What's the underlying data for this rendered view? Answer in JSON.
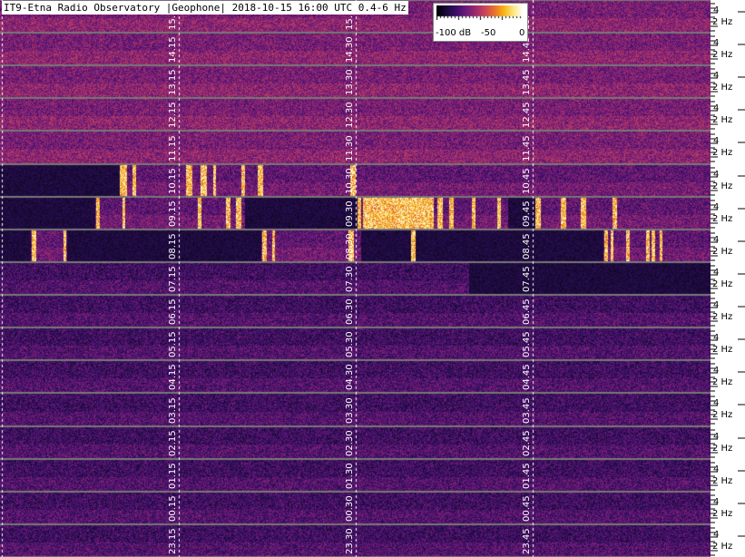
{
  "title": "IT9-Etna Radio Observatory |Geophone| 2018-10-15 16:00 UTC 0.4-6 Hz",
  "colorbar": {
    "min_label": "-100 dB",
    "mid_label": "-50",
    "max_label": "0",
    "colors": [
      "#000000",
      "#1a0b3b",
      "#3c0f69",
      "#6b1a7a",
      "#9b2b6e",
      "#c8455a",
      "#e8722e",
      "#f8b514",
      "#fbe985",
      "#ffffff"
    ]
  },
  "freq_labels": [
    "4",
    "2 Hz"
  ],
  "rows": [
    {
      "labels": [
        "15.",
        "15.",
        "15."
      ],
      "activity": "normal"
    },
    {
      "labels": [
        "14.15",
        "14.30",
        "14.45"
      ],
      "activity": "normal"
    },
    {
      "labels": [
        "13.15",
        "13.30",
        "13.45"
      ],
      "activity": "normal"
    },
    {
      "labels": [
        "12.15",
        "12.30",
        "12.45"
      ],
      "activity": "normal"
    },
    {
      "labels": [
        "11.15",
        "11.30",
        "11.45"
      ],
      "activity": "normal"
    },
    {
      "labels": [
        "10.15",
        "10.30",
        "10.45"
      ],
      "activity": "burst"
    },
    {
      "labels": [
        "09.15",
        "09.30",
        "09.45"
      ],
      "activity": "burst"
    },
    {
      "labels": [
        "08.15",
        "08.30",
        "08.45"
      ],
      "activity": "burst"
    },
    {
      "labels": [
        "07.15",
        "07.30",
        "07.45"
      ],
      "activity": "quiet"
    },
    {
      "labels": [
        "06.15",
        "06.30",
        "06.45"
      ],
      "activity": "quiet"
    },
    {
      "labels": [
        "05.15",
        "05.30",
        "05.45"
      ],
      "activity": "quiet"
    },
    {
      "labels": [
        "04.15",
        "04.30",
        "04.45"
      ],
      "activity": "quiet"
    },
    {
      "labels": [
        "03.15",
        "03.30",
        "03.45"
      ],
      "activity": "quiet"
    },
    {
      "labels": [
        "02.15",
        "02.30",
        "02.45"
      ],
      "activity": "quiet"
    },
    {
      "labels": [
        "01.15",
        "01.30",
        "01.45"
      ],
      "activity": "quiet"
    },
    {
      "labels": [
        "00.15",
        "00.30",
        "00.45"
      ],
      "activity": "quiet"
    },
    {
      "labels": [
        "23.15",
        "23.30",
        "23.45"
      ],
      "activity": "quiet"
    }
  ]
}
